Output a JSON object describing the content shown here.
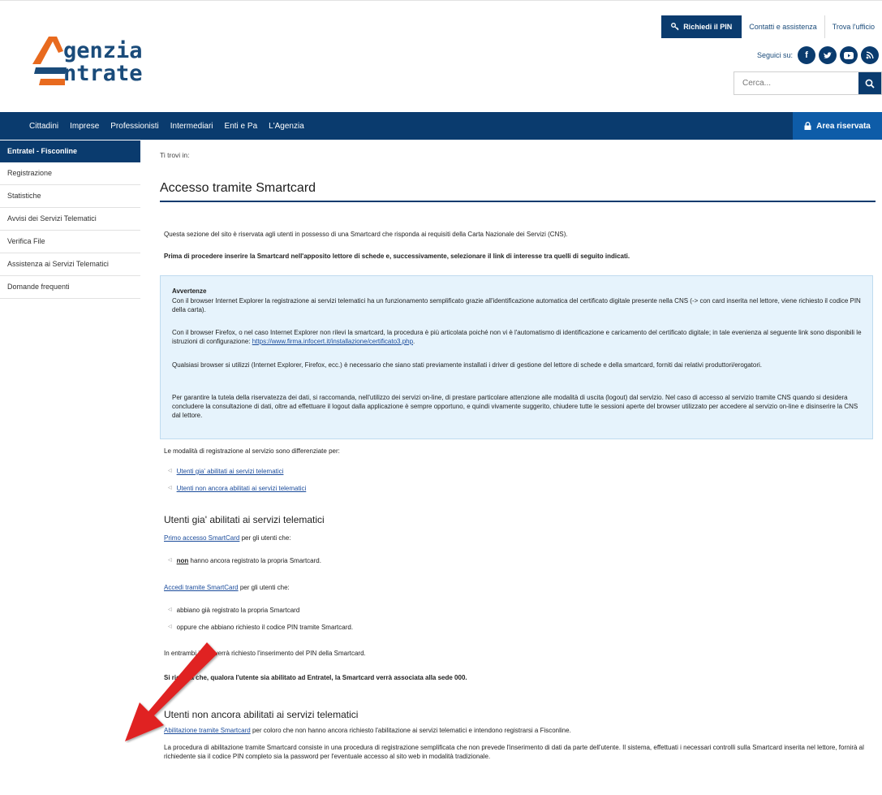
{
  "logo": {
    "line1": "genzia",
    "line2": "ntrate"
  },
  "top_links": {
    "pin": "Richiedi il PIN",
    "contact": "Contatti e assistenza",
    "office": "Trova l'ufficio"
  },
  "social": {
    "label": "Seguici su:",
    "icons": [
      "facebook-icon",
      "twitter-icon",
      "youtube-icon",
      "rss-icon"
    ]
  },
  "search": {
    "placeholder": "Cerca..."
  },
  "nav": {
    "items": [
      "Cittadini",
      "Imprese",
      "Professionisti",
      "Intermediari",
      "Enti e Pa",
      "L'Agenzia"
    ],
    "area_riservata": "Area riservata"
  },
  "sidebar": {
    "title": "Entratel - Fisconline",
    "items": [
      "Registrazione",
      "Statistiche",
      "Avvisi dei Servizi Telematici",
      "Verifica File",
      "Assistenza ai Servizi Telematici",
      "Domande frequenti"
    ]
  },
  "main": {
    "breadcrumb": "Ti trovi in:",
    "title": "Accesso tramite Smartcard",
    "intro": "Questa sezione del sito è riservata agli utenti in possesso di una Smartcard che risponda ai requisiti della Carta Nazionale dei Servizi (CNS).",
    "intro_bold": "Prima di procedere inserire la Smartcard nell'apposito lettore di schede e, successivamente, selezionare il link di interesse tra quelli di seguito indicati.",
    "warning": {
      "title": "Avvertenze",
      "p1": "Con il browser Internet Explorer la registrazione ai servizi telematici ha un funzionamento semplificato grazie all'identificazione automatica del certificato digitale presente nella CNS (-> con card inserita nel lettore, viene richiesto il codice PIN della carta).",
      "p2_text": "Con il browser Firefox, o nel caso Internet Explorer non rilevi la smartcard, la procedura è più articolata poiché non vi è l'automatismo di identificazione e caricamento del certificato digitale; in tale evenienza al seguente link sono disponibili le istruzioni di configurazione:",
      "p2_link": "https://www.firma.infocert.it/installazione/certificato3.php",
      "p3": "Qualsiasi browser si utilizzi (Internet Explorer, Firefox, ecc.) è necessario che siano stati previamente installati i driver di gestione del lettore di schede e della smartcard, forniti dai relativi produttori/erogatori.",
      "p4": "Per garantire la tutela della riservatezza dei dati, si raccomanda, nell'utilizzo dei servizi on-line, di prestare particolare attenzione alle modalità di uscita (logout) dal servizio. Nel caso di accesso al servizio tramite CNS quando si desidera concludere la consultazione di dati, oltre ad effettuare il logout dalla applicazione è sempre opportuno, e quindi vivamente suggerito, chiudere tutte le sessioni aperte del browser utilizzato per accedere al servizio on-line e disinserire la CNS dal lettore."
    },
    "modes_intro": "Le modalità di registrazione al servizio sono differenziate per:",
    "modes_links": [
      "Utenti gia' abilitati ai servizi telematici",
      "Utenti non ancora abilitati ai servizi telematici"
    ],
    "section1": {
      "title": "Utenti gia' abilitati ai servizi telematici",
      "first_link": "Primo accesso SmartCard",
      "first_suffix": "per gli utenti che:",
      "first_bullet_bold": "non",
      "first_bullet_rest": "hanno ancora registrato la propria Smartcard.",
      "second_link": "Accedi tramite SmartCard",
      "second_suffix": "per gli utenti che:",
      "bullets": [
        "abbiano già registrato la propria Smartcard",
        "oppure che abbiano richiesto il codice PIN tramite Smartcard."
      ],
      "note": "In entrambi i casi verrà richiesto l'inserimento del PIN della Smartcard.",
      "note_bold": "Si ricorda che, qualora l'utente sia abilitato ad Entratel, la Smartcard verrà associata alla sede 000."
    },
    "section2": {
      "title": "Utenti non ancora abilitati ai servizi telematici",
      "link": "Abilitazione tramite Smartcard",
      "link_suffix": "per coloro che non hanno ancora richiesto l'abilitazione ai servizi telematici e intendono registrarsi a Fisconline.",
      "para": "La procedura di abilitazione tramite Smartcard consiste in una procedura di registrazione semplificata che non prevede l'inserimento di dati da parte dell'utente. Il sistema, effettuati i necessari controlli sulla Smartcard inserita nel lettore, fornirà al richiedente sia il codice PIN completo sia la password per l'eventuale accesso al sito web in modalità tradizionale."
    }
  },
  "colors": {
    "brand_blue": "#0a3b6e",
    "accent_blue": "#0e5ca8",
    "logo_orange": "#e86a1e",
    "warn_bg": "#e6f3fc",
    "arrow_red": "#e02020"
  }
}
